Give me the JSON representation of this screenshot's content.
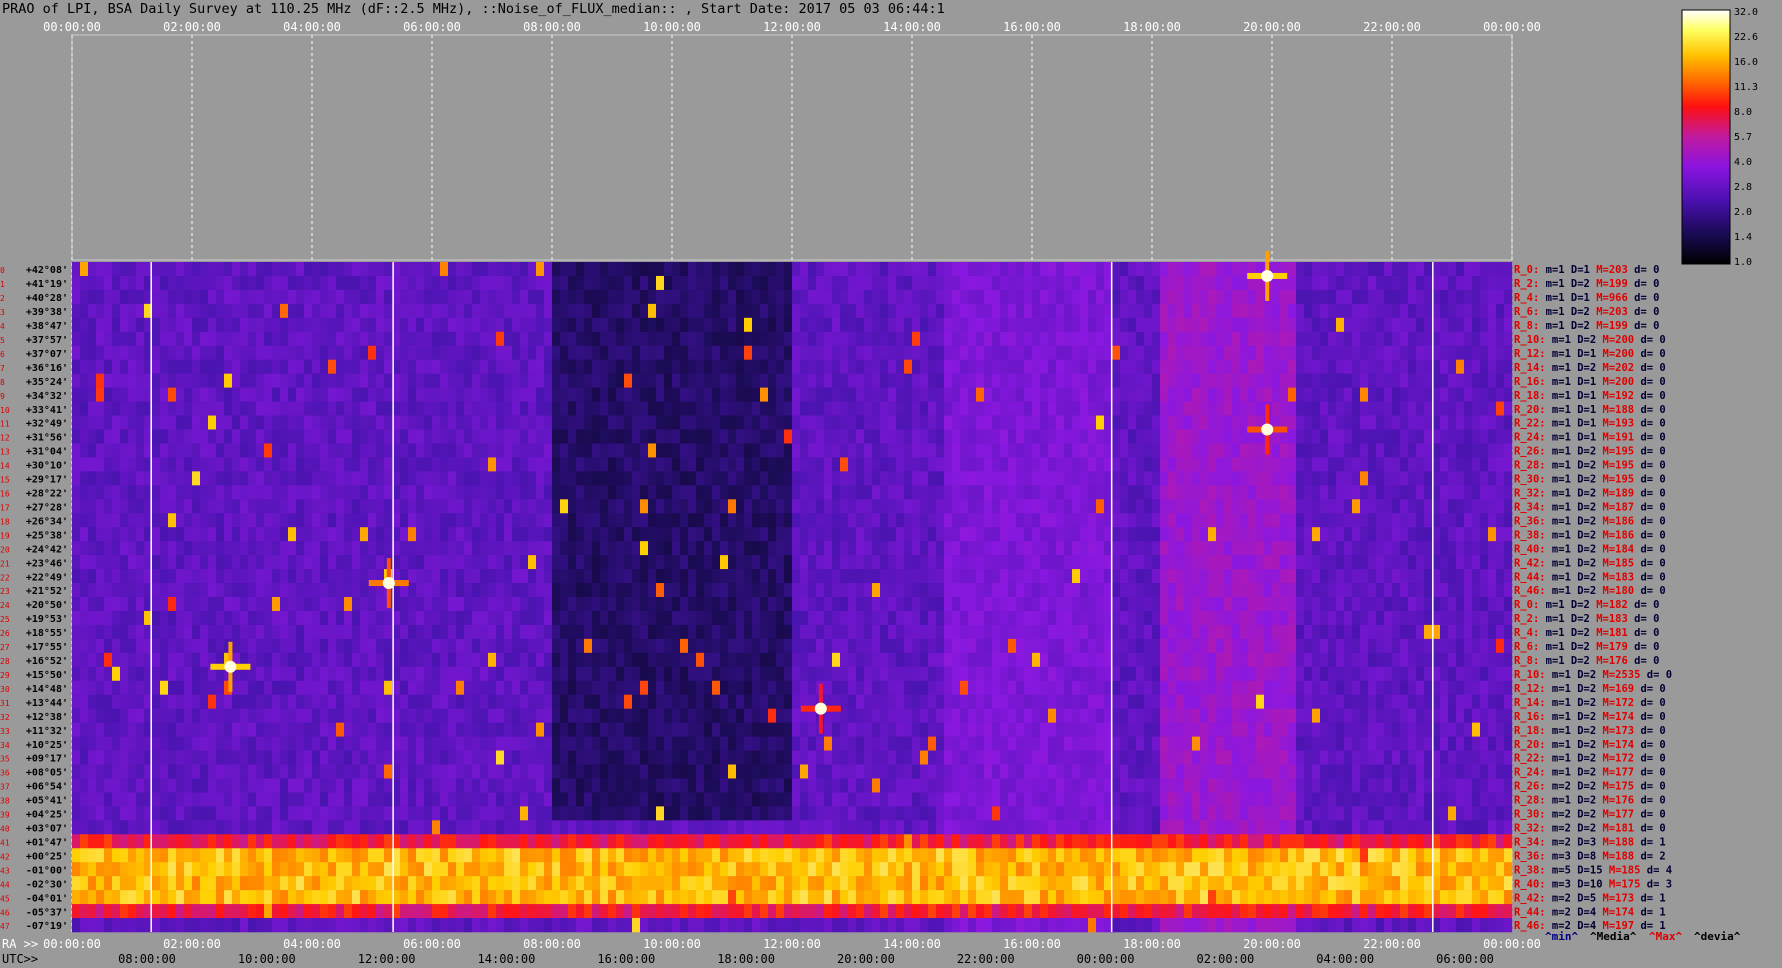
{
  "title": "PRAO of LPI, BSA Daily Survey at 110.25 MHz (dF::2.5 MHz), ::Noise_of_FLUX_median:: , Start Date: 2017 05 03 06:44:1",
  "colors": {
    "background": "#9a9a9a",
    "plot_bg": "#20104a"
  },
  "chart_data": {
    "type": "heatmap",
    "title": "PRAO of LPI, BSA Daily Survey at 110.25 MHz (dF::2.5 MHz), ::Noise_of_FLUX_median:: , Start Date: 2017 05 03 06:44:1",
    "top_axis_ticks": [
      "00:00:00",
      "02:00:00",
      "04:00:00",
      "06:00:00",
      "08:00:00",
      "10:00:00",
      "12:00:00",
      "14:00:00",
      "16:00:00",
      "18:00:00",
      "20:00:00",
      "22:00:00",
      "00:00:00"
    ],
    "ra_axis": {
      "label": "RA >>",
      "ticks": [
        "00:00:00",
        "02:00:00",
        "04:00:00",
        "06:00:00",
        "08:00:00",
        "10:00:00",
        "12:00:00",
        "14:00:00",
        "16:00:00",
        "18:00:00",
        "20:00:00",
        "22:00:00",
        "00:00:00"
      ]
    },
    "utc_axis": {
      "label": "UTC>>",
      "ticks": [
        "08:00:00",
        "10:00:00",
        "12:00:00",
        "14:00:00",
        "16:00:00",
        "18:00:00",
        "20:00:00",
        "22:00:00",
        "00:00:00",
        "02:00:00",
        "04:00:00",
        "06:00:00"
      ]
    },
    "declination_labels": [
      "+42°08'",
      "+41°19'",
      "+40°28'",
      "+39°38'",
      "+38°47'",
      "+37°57'",
      "+37°07'",
      "+36°16'",
      "+35°24'",
      "+34°32'",
      "+33°41'",
      "+32°49'",
      "+31°56'",
      "+31°04'",
      "+30°10'",
      "+29°17'",
      "+28°22'",
      "+27°28'",
      "+26°34'",
      "+25°38'",
      "+24°42'",
      "+23°46'",
      "+22°49'",
      "+21°52'",
      "+20°50'",
      "+19°53'",
      "+18°55'",
      "+17°55'",
      "+16°52'",
      "+15°50'",
      "+14°48'",
      "+13°44'",
      "+12°38'",
      "+11°32'",
      "+10°25'",
      "+09°17'",
      "+08°05'",
      "+06°54'",
      "+05°41'",
      "+04°25'",
      "+03°07'",
      "+01°47'",
      "+00°25'",
      "-01°00'",
      "-02°30'",
      "-04°01'",
      "-05°37'",
      "-07°19'"
    ],
    "colorbar": {
      "ticks": [
        "32.0",
        "22.6",
        "16.0",
        "11.3",
        "8.0",
        "5.7",
        "4.0",
        "2.8",
        "2.0",
        "1.4",
        "1.0"
      ],
      "scale": "log"
    },
    "legend": [
      {
        "text": "^min^",
        "color": "#000080"
      },
      {
        "text": "^Media^",
        "color": "#000000"
      },
      {
        "text": "^Max^",
        "color": "#e00000"
      },
      {
        "text": "^devia^",
        "color": "#000000"
      }
    ],
    "row_stats": [
      {
        "r": "R_0:",
        "m": "m=1",
        "D": "D=1",
        "M": "M=203",
        "d": "d= 0"
      },
      {
        "r": "R_2:",
        "m": "m=1",
        "D": "D=2",
        "M": "M=199",
        "d": "d= 0"
      },
      {
        "r": "R_4:",
        "m": "m=1",
        "D": "D=1",
        "M": "M=966",
        "d": "d= 0"
      },
      {
        "r": "R_6:",
        "m": "m=1",
        "D": "D=2",
        "M": "M=203",
        "d": "d= 0"
      },
      {
        "r": "R_8:",
        "m": "m=1",
        "D": "D=2",
        "M": "M=199",
        "d": "d= 0"
      },
      {
        "r": "R_10:",
        "m": "m=1",
        "D": "D=2",
        "M": "M=200",
        "d": "d= 0"
      },
      {
        "r": "R_12:",
        "m": "m=1",
        "D": "D=1",
        "M": "M=200",
        "d": "d= 0"
      },
      {
        "r": "R_14:",
        "m": "m=1",
        "D": "D=2",
        "M": "M=202",
        "d": "d= 0"
      },
      {
        "r": "R_16:",
        "m": "m=1",
        "D": "D=1",
        "M": "M=200",
        "d": "d= 0"
      },
      {
        "r": "R_18:",
        "m": "m=1",
        "D": "D=1",
        "M": "M=192",
        "d": "d= 0"
      },
      {
        "r": "R_20:",
        "m": "m=1",
        "D": "D=1",
        "M": "M=188",
        "d": "d= 0"
      },
      {
        "r": "R_22:",
        "m": "m=1",
        "D": "D=1",
        "M": "M=193",
        "d": "d= 0"
      },
      {
        "r": "R_24:",
        "m": "m=1",
        "D": "D=1",
        "M": "M=191",
        "d": "d= 0"
      },
      {
        "r": "R_26:",
        "m": "m=1",
        "D": "D=2",
        "M": "M=195",
        "d": "d= 0"
      },
      {
        "r": "R_28:",
        "m": "m=1",
        "D": "D=2",
        "M": "M=195",
        "d": "d= 0"
      },
      {
        "r": "R_30:",
        "m": "m=1",
        "D": "D=2",
        "M": "M=195",
        "d": "d= 0"
      },
      {
        "r": "R_32:",
        "m": "m=1",
        "D": "D=2",
        "M": "M=189",
        "d": "d= 0"
      },
      {
        "r": "R_34:",
        "m": "m=1",
        "D": "D=2",
        "M": "M=187",
        "d": "d= 0"
      },
      {
        "r": "R_36:",
        "m": "m=1",
        "D": "D=2",
        "M": "M=186",
        "d": "d= 0"
      },
      {
        "r": "R_38:",
        "m": "m=1",
        "D": "D=2",
        "M": "M=186",
        "d": "d= 0"
      },
      {
        "r": "R_40:",
        "m": "m=1",
        "D": "D=2",
        "M": "M=184",
        "d": "d= 0"
      },
      {
        "r": "R_42:",
        "m": "m=1",
        "D": "D=2",
        "M": "M=185",
        "d": "d= 0"
      },
      {
        "r": "R_44:",
        "m": "m=1",
        "D": "D=2",
        "M": "M=183",
        "d": "d= 0"
      },
      {
        "r": "R_46:",
        "m": "m=1",
        "D": "D=2",
        "M": "M=180",
        "d": "d= 0"
      },
      {
        "r": "R_0:",
        "m": "m=1",
        "D": "D=2",
        "M": "M=182",
        "d": "d= 0"
      },
      {
        "r": "R_2:",
        "m": "m=1",
        "D": "D=2",
        "M": "M=183",
        "d": "d= 0"
      },
      {
        "r": "R_4:",
        "m": "m=1",
        "D": "D=2",
        "M": "M=181",
        "d": "d= 0"
      },
      {
        "r": "R_6:",
        "m": "m=1",
        "D": "D=2",
        "M": "M=179",
        "d": "d= 0"
      },
      {
        "r": "R_8:",
        "m": "m=1",
        "D": "D=2",
        "M": "M=176",
        "d": "d= 0"
      },
      {
        "r": "R_10:",
        "m": "m=1",
        "D": "D=2",
        "M": "M=2535",
        "d": "d= 0"
      },
      {
        "r": "R_12:",
        "m": "m=1",
        "D": "D=2",
        "M": "M=169",
        "d": "d= 0"
      },
      {
        "r": "R_14:",
        "m": "m=1",
        "D": "D=2",
        "M": "M=172",
        "d": "d= 0"
      },
      {
        "r": "R_16:",
        "m": "m=1",
        "D": "D=2",
        "M": "M=174",
        "d": "d= 0"
      },
      {
        "r": "R_18:",
        "m": "m=1",
        "D": "D=2",
        "M": "M=173",
        "d": "d= 0"
      },
      {
        "r": "R_20:",
        "m": "m=1",
        "D": "D=2",
        "M": "M=174",
        "d": "d= 0"
      },
      {
        "r": "R_22:",
        "m": "m=1",
        "D": "D=2",
        "M": "M=172",
        "d": "d= 0"
      },
      {
        "r": "R_24:",
        "m": "m=1",
        "D": "D=2",
        "M": "M=177",
        "d": "d= 0"
      },
      {
        "r": "R_26:",
        "m": "m=2",
        "D": "D=2",
        "M": "M=175",
        "d": "d= 0"
      },
      {
        "r": "R_28:",
        "m": "m=1",
        "D": "D=2",
        "M": "M=176",
        "d": "d= 0"
      },
      {
        "r": "R_30:",
        "m": "m=2",
        "D": "D=2",
        "M": "M=177",
        "d": "d= 0"
      },
      {
        "r": "R_32:",
        "m": "m=2",
        "D": "D=2",
        "M": "M=181",
        "d": "d= 0"
      },
      {
        "r": "R_34:",
        "m": "m=2",
        "D": "D=3",
        "M": "M=188",
        "d": "d= 1"
      },
      {
        "r": "R_36:",
        "m": "m=3",
        "D": "D=8",
        "M": "M=188",
        "d": "d= 2"
      },
      {
        "r": "R_38:",
        "m": "m=5",
        "D": "D=15",
        "M": "M=185",
        "d": "d= 4"
      },
      {
        "r": "R_40:",
        "m": "m=3",
        "D": "D=10",
        "M": "M=175",
        "d": "d= 3"
      },
      {
        "r": "R_42:",
        "m": "m=2",
        "D": "D=5",
        "M": "M=173",
        "d": "d= 1"
      },
      {
        "r": "R_44:",
        "m": "m=2",
        "D": "D=4",
        "M": "M=174",
        "d": "d= 1"
      },
      {
        "r": "R_46:",
        "m": "m=2",
        "D": "D=4",
        "M": "M=197",
        "d": "d= 1"
      }
    ]
  }
}
